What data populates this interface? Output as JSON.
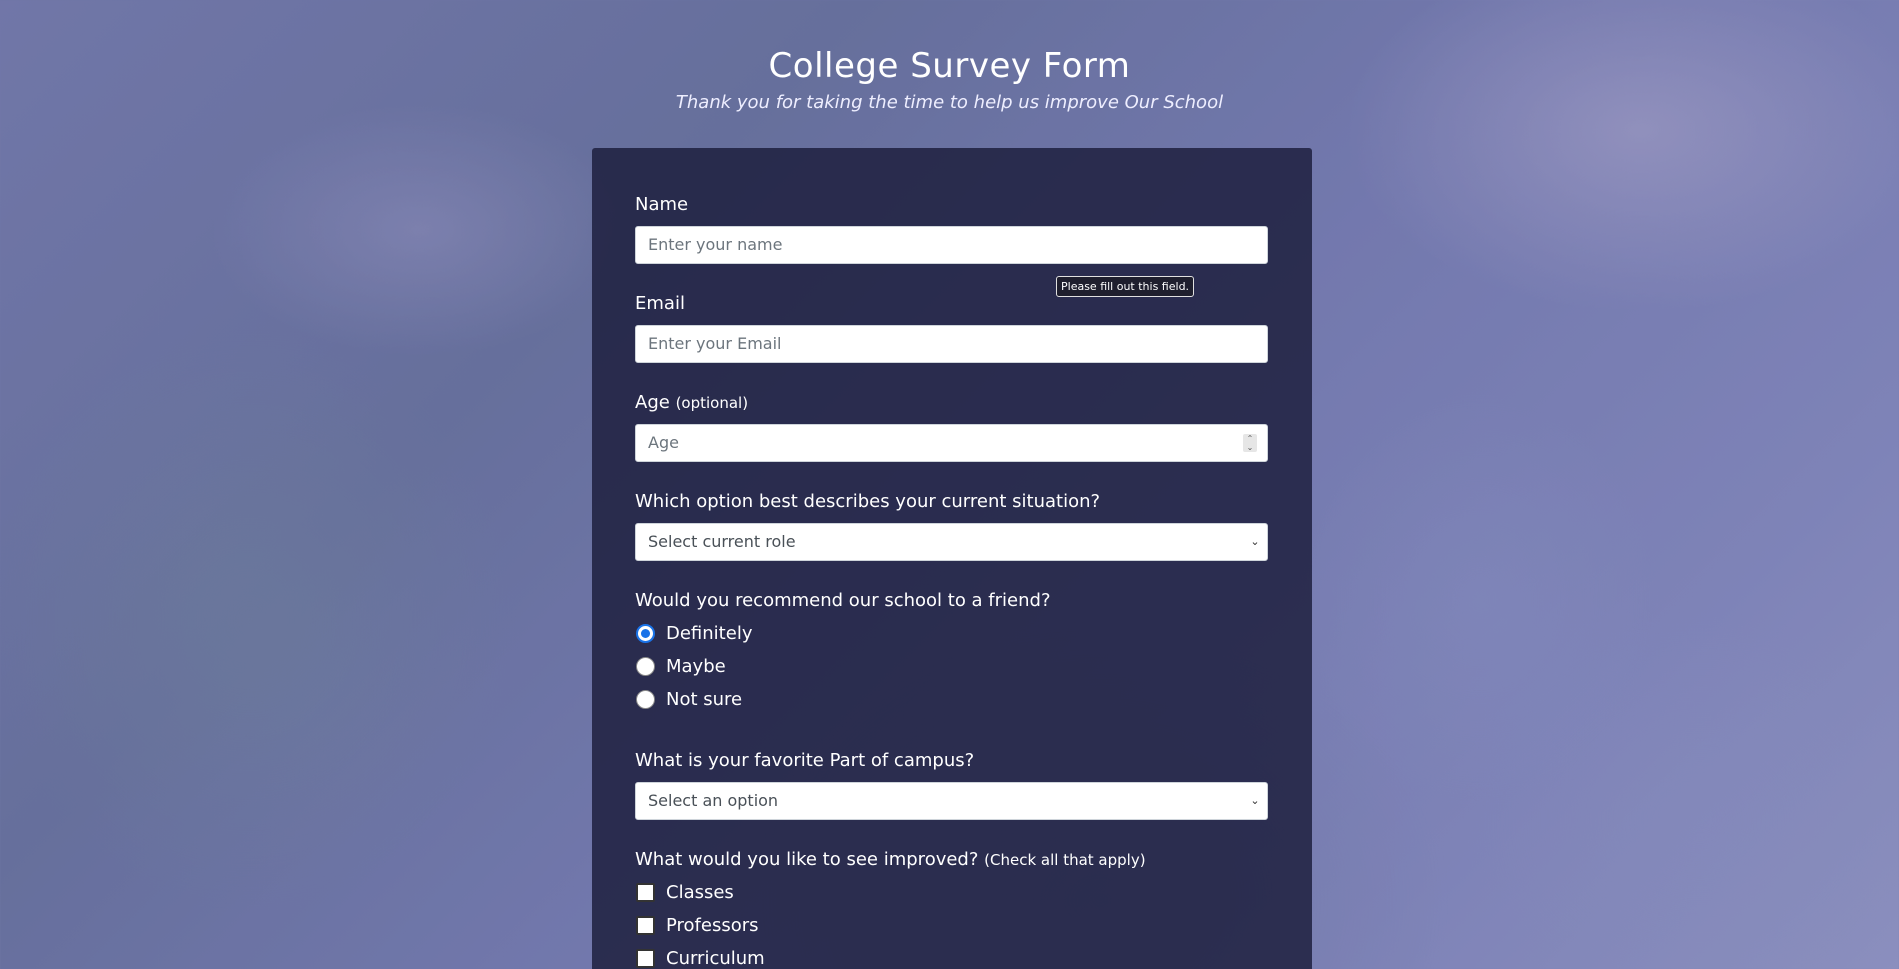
{
  "header": {
    "title": "College Survey Form",
    "subtitle": "Thank you for taking the time to help us improve Our School"
  },
  "form": {
    "name": {
      "label": "Name",
      "placeholder": "Enter your name"
    },
    "tooltip": "Please fill out this field.",
    "email": {
      "label": "Email",
      "placeholder": "Enter your Email"
    },
    "age": {
      "label": "Age",
      "note": "(optional)",
      "placeholder": "Age"
    },
    "role": {
      "label": "Which option best describes your current situation?",
      "selected": "Select current role"
    },
    "recommend": {
      "label": "Would you recommend our school to a friend?",
      "options": [
        "Definitely",
        "Maybe",
        "Not sure"
      ],
      "checked": "Definitely"
    },
    "favorite": {
      "label": "What is your favorite Part of campus?",
      "selected": "Select an option"
    },
    "improve": {
      "label": "What would you like to see improved?",
      "note": "(Check all that apply)",
      "options": [
        "Classes",
        "Professors",
        "Curriculum"
      ]
    }
  },
  "icons": {
    "select_arrow": "chevron-down-icon",
    "number_spinner": "spinner-icon"
  }
}
